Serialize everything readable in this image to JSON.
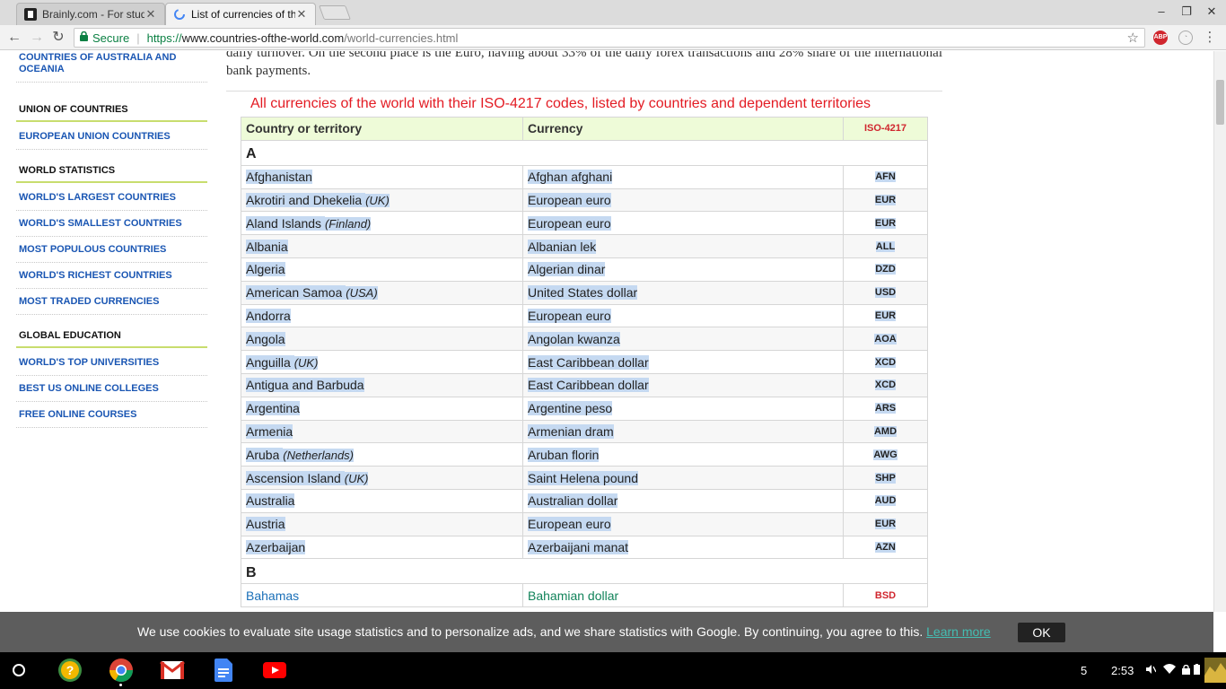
{
  "tabs": [
    {
      "title": "Brainly.com - For studen"
    },
    {
      "title": "List of currencies of the w"
    }
  ],
  "omnibox": {
    "secure_label": "Secure",
    "scheme": "https://",
    "host": "www.countries-ofthe-world.com",
    "path": "/world-currencies.html"
  },
  "extensions": {
    "abp_label": "ABP"
  },
  "sidebar": {
    "top_link": "COUNTRIES OF AUSTRALIA AND OCEANIA",
    "sections": [
      {
        "heading": "UNION OF COUNTRIES",
        "links": [
          "EUROPEAN UNION COUNTRIES"
        ]
      },
      {
        "heading": "WORLD STATISTICS",
        "links": [
          "WORLD'S LARGEST COUNTRIES",
          "WORLD'S SMALLEST COUNTRIES",
          "MOST POPULOUS COUNTRIES",
          "WORLD'S RICHEST COUNTRIES",
          "MOST TRADED CURRENCIES"
        ]
      },
      {
        "heading": "GLOBAL EDUCATION",
        "links": [
          "WORLD'S TOP UNIVERSITIES",
          "BEST US ONLINE COLLEGES",
          "FREE ONLINE COURSES"
        ]
      }
    ]
  },
  "article": {
    "intro_text": "daily turnover. On the second place is the Euro, having about 33% of the daily forex transactions and 28% share of the international bank payments.",
    "table_title": "All currencies of the world with their ISO-4217 codes, listed by countries and dependent territories"
  },
  "table": {
    "headers": {
      "country": "Country or territory",
      "currency": "Currency",
      "iso": "ISO-4217"
    },
    "groups": [
      {
        "letter": "A",
        "rows": [
          {
            "country": "Afghanistan",
            "note": "",
            "currency": "Afghan afghani",
            "code": "AFN"
          },
          {
            "country": "Akrotiri and Dhekelia",
            "note": "(UK)",
            "currency": "European euro",
            "code": "EUR"
          },
          {
            "country": "Aland Islands",
            "note": "(Finland)",
            "currency": "European euro",
            "code": "EUR"
          },
          {
            "country": "Albania",
            "note": "",
            "currency": "Albanian lek",
            "code": "ALL"
          },
          {
            "country": "Algeria",
            "note": "",
            "currency": "Algerian dinar",
            "code": "DZD"
          },
          {
            "country": "American Samoa",
            "note": "(USA)",
            "currency": "United States dollar",
            "code": "USD"
          },
          {
            "country": "Andorra",
            "note": "",
            "currency": "European euro",
            "code": "EUR"
          },
          {
            "country": "Angola",
            "note": "",
            "currency": "Angolan kwanza",
            "code": "AOA"
          },
          {
            "country": "Anguilla",
            "note": "(UK)",
            "currency": "East Caribbean dollar",
            "code": "XCD"
          },
          {
            "country": "Antigua and Barbuda",
            "note": "",
            "currency": "East Caribbean dollar",
            "code": "XCD"
          },
          {
            "country": "Argentina",
            "note": "",
            "currency": "Argentine peso",
            "code": "ARS"
          },
          {
            "country": "Armenia",
            "note": "",
            "currency": "Armenian dram",
            "code": "AMD"
          },
          {
            "country": "Aruba",
            "note": "(Netherlands)",
            "currency": "Aruban florin",
            "code": "AWG"
          },
          {
            "country": "Ascension Island",
            "note": "(UK)",
            "currency": "Saint Helena pound",
            "code": "SHP"
          },
          {
            "country": "Australia",
            "note": "",
            "currency": "Australian dollar",
            "code": "AUD"
          },
          {
            "country": "Austria",
            "note": "",
            "currency": "European euro",
            "code": "EUR"
          },
          {
            "country": "Azerbaijan",
            "note": "",
            "currency": "Azerbaijani manat",
            "code": "AZN"
          }
        ]
      },
      {
        "letter": "B",
        "rows": [
          {
            "country": "Bahamas",
            "note": "",
            "currency": "Bahamian dollar",
            "code": "BSD"
          }
        ]
      }
    ]
  },
  "cookie_bar": {
    "message": "We use cookies to evaluate site usage statistics and to personalize ads, and we share statistics with Google. By continuing, you agree to this.",
    "learn_more": "Learn more",
    "ok_label": "OK"
  },
  "shelf": {
    "apps": [
      "launcher-icon",
      "help-icon",
      "chrome-icon",
      "gmail-icon",
      "docs-icon",
      "youtube-icon"
    ],
    "notification_count": "5",
    "clock": "2:53"
  },
  "colors": {
    "link_blue": "#1a56b3",
    "heading_red": "#e31b23",
    "selection_blue": "#c5d9f1",
    "header_green": "#eefbd8",
    "cookie_bar_bg": "#5d5d5d",
    "learn_more_teal": "#44bdb2"
  }
}
